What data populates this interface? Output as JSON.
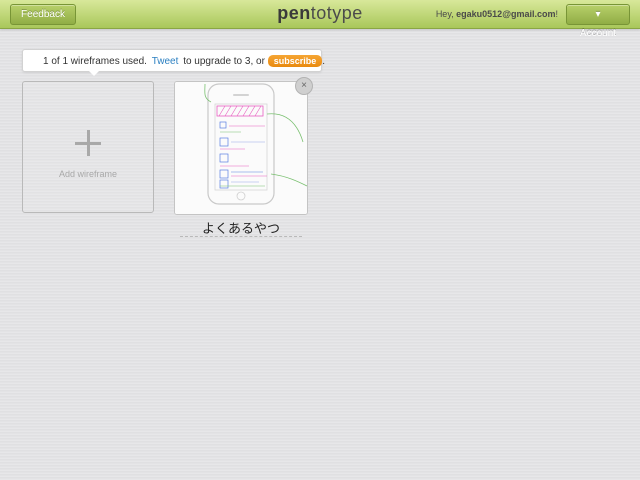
{
  "topbar": {
    "feedback_label": "Feedback",
    "logo_bold": "pen",
    "logo_light": "totype",
    "greeting_prefix": "Hey, ",
    "user_email": "egaku0512@gmail.com",
    "greeting_suffix": "!",
    "account_label": "▾ Account"
  },
  "notice": {
    "text_before": "1 of 1 wireframes used.",
    "tweet_label": "Tweet",
    "text_middle": "to upgrade to 3, or",
    "subscribe_label": "subscribe",
    "text_after": "."
  },
  "add_card": {
    "label": "Add wireframe"
  },
  "wireframes": [
    {
      "title": "よくあるやつ",
      "close_symbol": "×"
    }
  ],
  "colors": {
    "topbar": "#b8d06a",
    "tweet_link": "#2a7fc1",
    "subscribe_button": "#ef9721",
    "sketch_pink": "#e85fc1",
    "sketch_blue": "#5a7ee0",
    "sketch_green": "#7ac070"
  }
}
